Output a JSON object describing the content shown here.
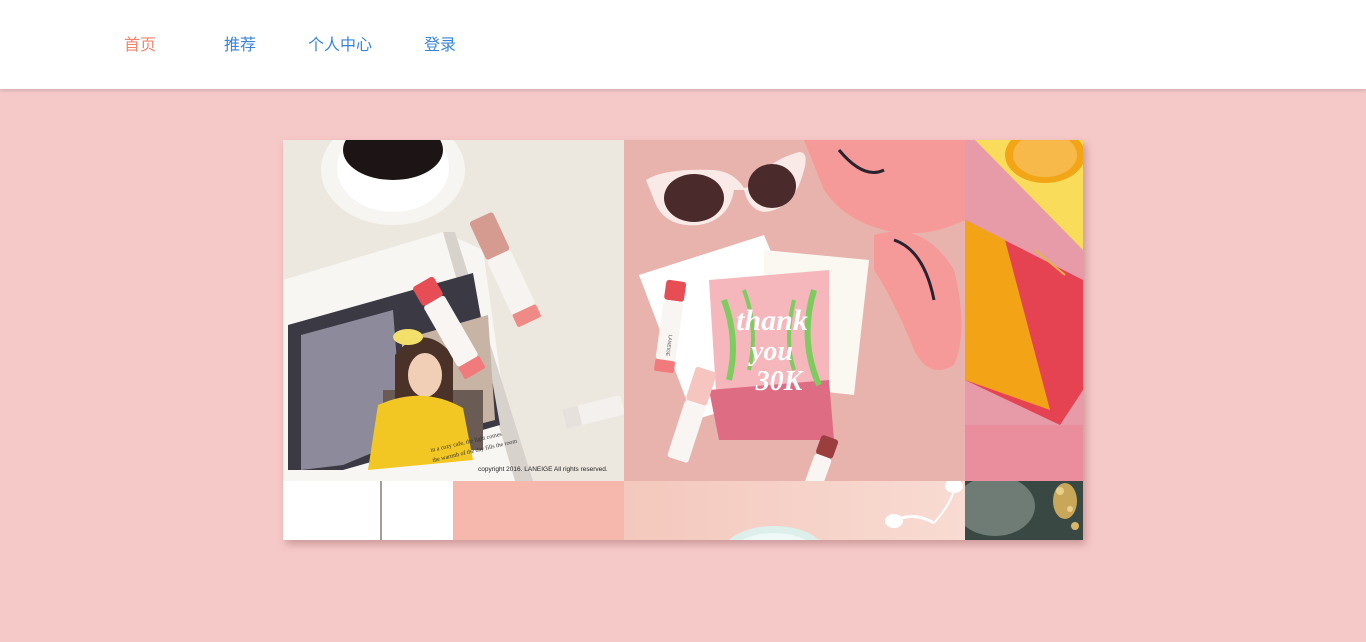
{
  "nav": {
    "items": [
      {
        "label": "首页",
        "active": true
      },
      {
        "label": "推荐",
        "active": false
      },
      {
        "label": "个人中心",
        "active": false
      },
      {
        "label": "登录",
        "active": false
      }
    ]
  },
  "colors": {
    "page_background": "#f6c9c9",
    "nav_link": "#3a86d6",
    "nav_active": "#f0846c"
  },
  "gallery": {
    "tile1": {
      "copyright": "copyright 2016. LANEIGE All rights reserved.",
      "handwriting_line1": "in a cozy cafe, the light comes",
      "handwriting_line2": "the warmth of the day fills the room"
    },
    "tile2": {
      "card_line1": "thank",
      "card_line2": "you",
      "card_line3": "30K",
      "lipstick_brand": "LANEIGE"
    }
  }
}
